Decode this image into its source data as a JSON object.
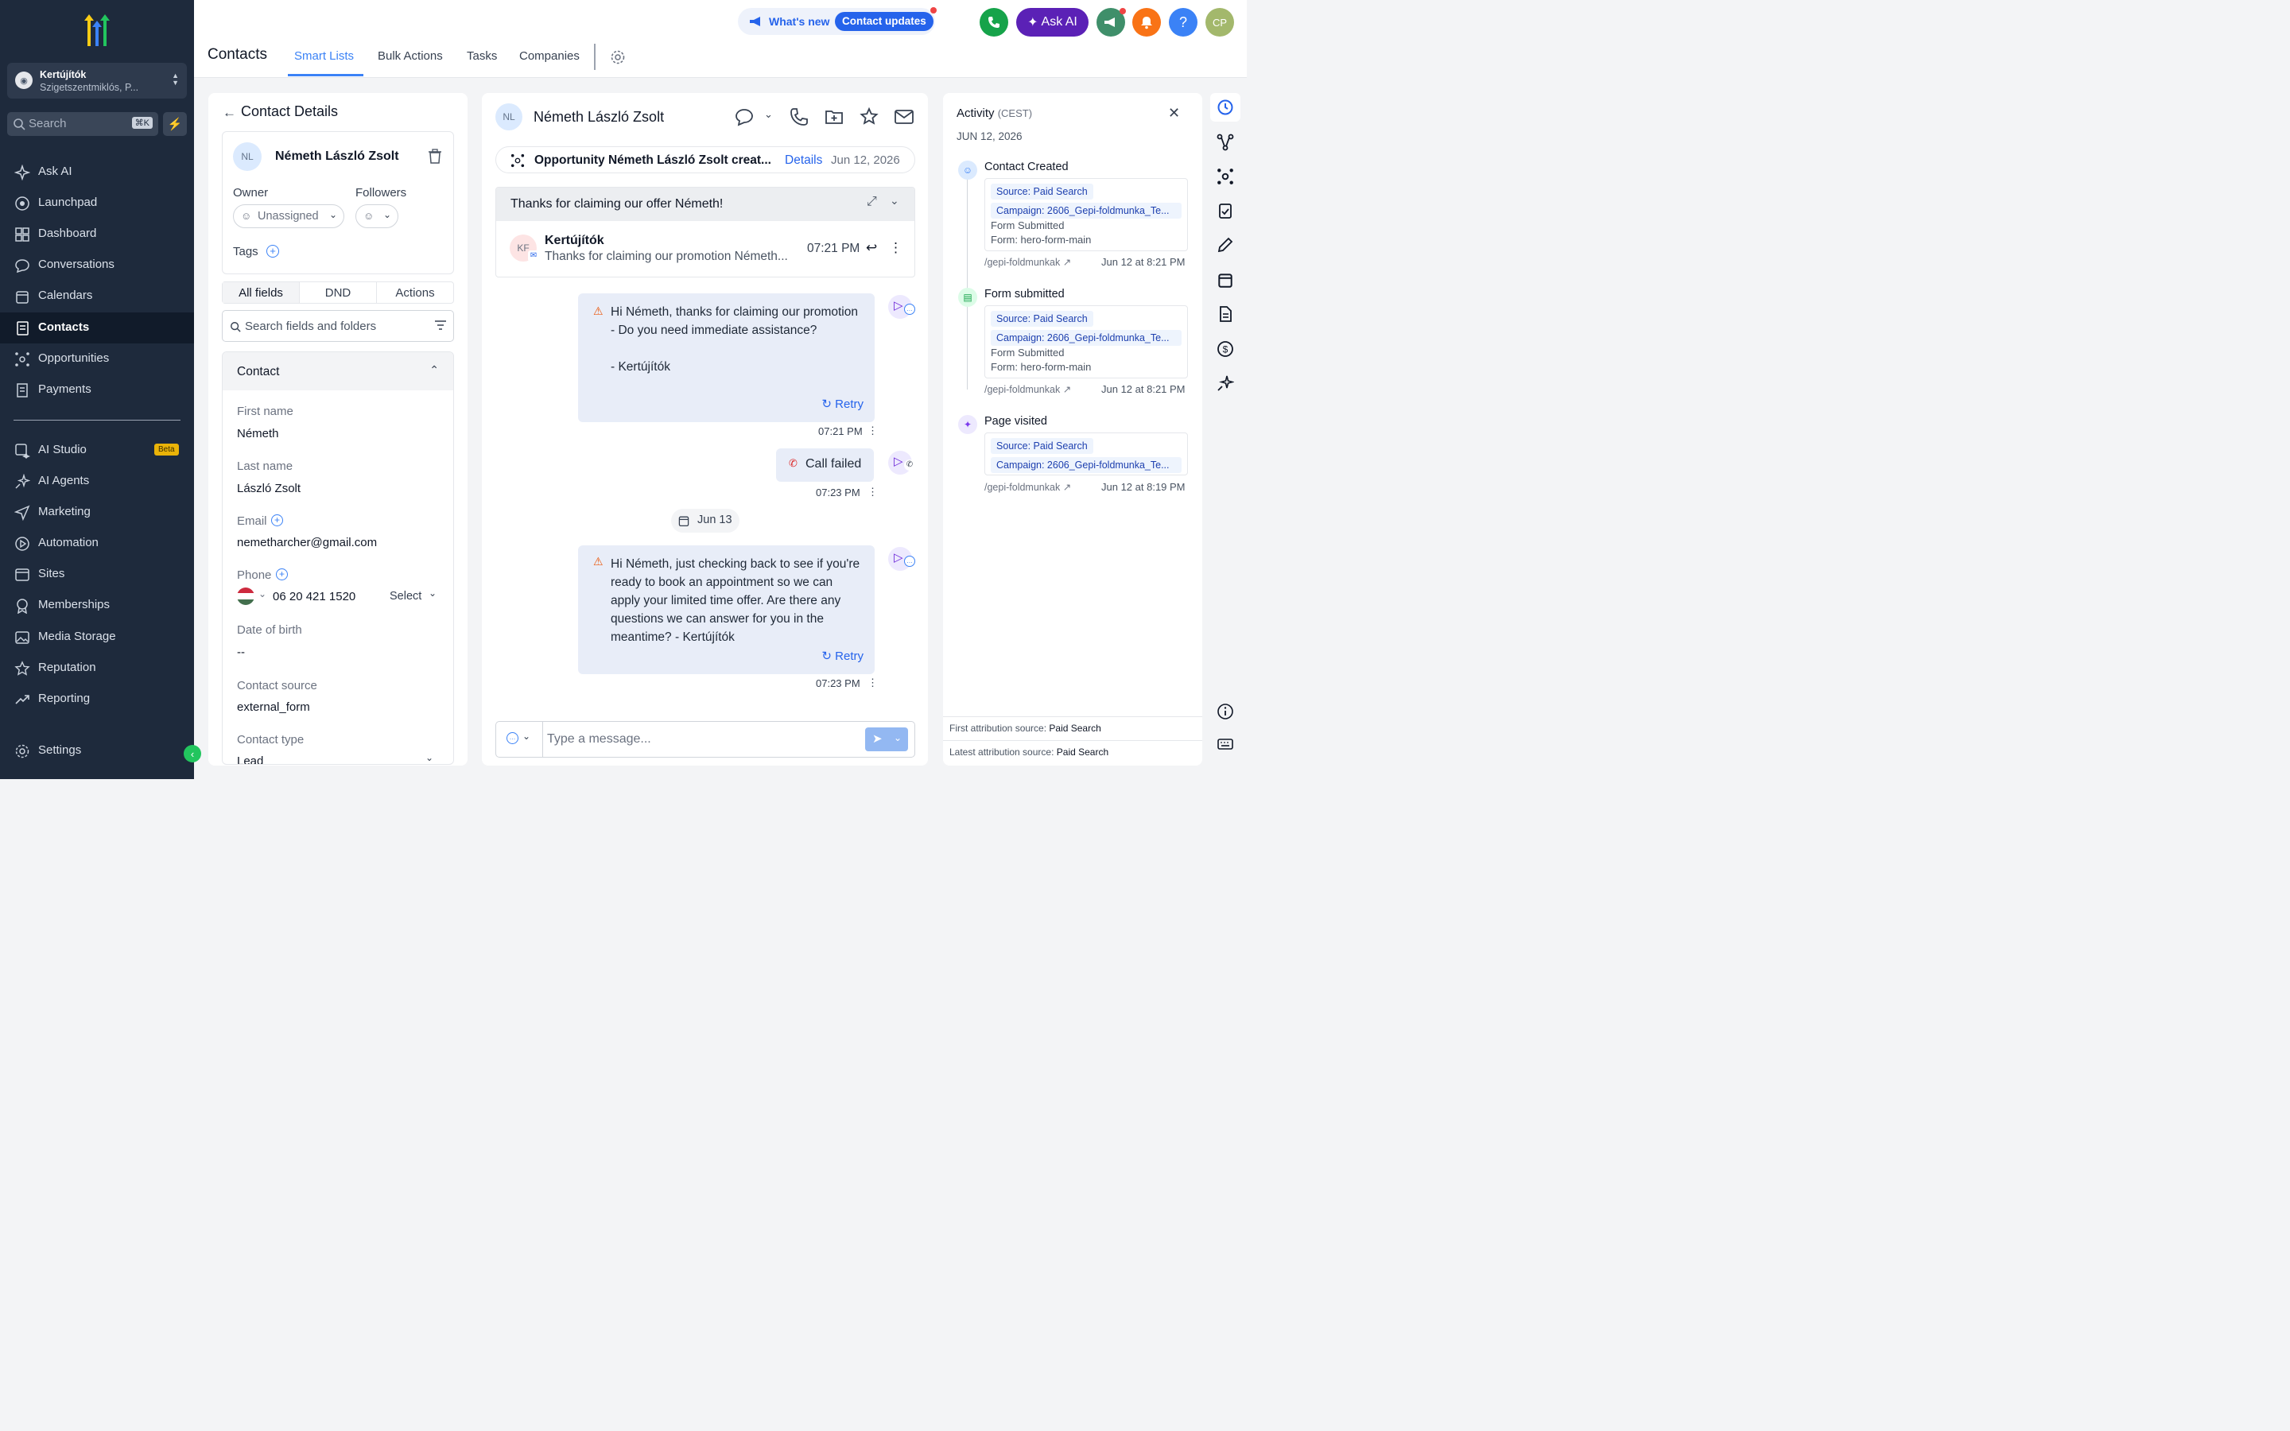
{
  "sidebar": {
    "location_name": "Kertújítók",
    "location_sub": "Szigetszentmiklós, P...",
    "search_placeholder": "Search",
    "search_shortcut": "⌘K",
    "items": [
      {
        "label": "Ask AI"
      },
      {
        "label": "Launchpad"
      },
      {
        "label": "Dashboard"
      },
      {
        "label": "Conversations"
      },
      {
        "label": "Calendars"
      },
      {
        "label": "Contacts"
      },
      {
        "label": "Opportunities"
      },
      {
        "label": "Payments"
      },
      {
        "label": "AI Studio",
        "badge": "Beta"
      },
      {
        "label": "AI Agents"
      },
      {
        "label": "Marketing"
      },
      {
        "label": "Automation"
      },
      {
        "label": "Sites"
      },
      {
        "label": "Memberships"
      },
      {
        "label": "Media Storage"
      },
      {
        "label": "Reputation"
      },
      {
        "label": "Reporting"
      },
      {
        "label": "Settings"
      }
    ]
  },
  "header": {
    "title": "Contacts",
    "tabs": [
      "Smart Lists",
      "Bulk Actions",
      "Tasks",
      "Companies"
    ],
    "whats_new": "What's new",
    "contact_updates": "Contact updates",
    "ask_ai": "Ask AI",
    "avatar": "CP"
  },
  "contact": {
    "panel_title": "Contact Details",
    "initials": "NL",
    "name": "Németh László Zsolt",
    "owner_label": "Owner",
    "owner_value": "Unassigned",
    "followers_label": "Followers",
    "tags_label": "Tags",
    "tabs": [
      "All fields",
      "DND",
      "Actions"
    ],
    "search_placeholder": "Search fields and folders",
    "section": "Contact",
    "fields": {
      "first_name_label": "First name",
      "first_name": "Németh",
      "last_name_label": "Last name",
      "last_name": "László Zsolt",
      "email_label": "Email",
      "email": "nemetharcher@gmail.com",
      "phone_label": "Phone",
      "phone": "06 20 421 1520",
      "phone_select": "Select",
      "dob_label": "Date of birth",
      "dob": "--",
      "source_label": "Contact source",
      "source": "external_form",
      "type_label": "Contact type",
      "type": "Lead"
    }
  },
  "conversation": {
    "initials": "NL",
    "name": "Németh László Zsolt",
    "opportunity_text": "Opportunity Németh László Zsolt creat...",
    "opportunity_link": "Details",
    "opportunity_date": "Jun 12, 2026",
    "thread_subject": "Thanks for claiming our offer Németh!",
    "email_initials": "KF",
    "email_from": "Kertújítók",
    "email_preview": "Thanks for claiming our promotion Németh...",
    "email_time": "07:21 PM",
    "messages": [
      {
        "text": "Hi Németh, thanks for claiming our promotion - Do you need immediate assistance?\n\n- Kertújítók",
        "retry": "Retry",
        "time": "07:21 PM"
      },
      {
        "text": "Call failed",
        "time": "07:23 PM"
      },
      {
        "text": "Hi Németh, just checking back to see if you're ready to book an appointment so we can apply your limited time offer. Are there any questions we can answer for you in the meantime? - Kertújítók",
        "retry": "Retry",
        "time": "07:23 PM"
      }
    ],
    "date_divider": "Jun 13",
    "composer_placeholder": "Type a message..."
  },
  "activity": {
    "title": "Activity",
    "tz": "(CEST)",
    "date": "JUN 12, 2026",
    "items": [
      {
        "title": "Contact Created",
        "source": "Source: Paid Search",
        "campaign": "Campaign: 2606_Gepi-foldmunka_Te...",
        "line1": "Form Submitted",
        "line2": "Form: hero-form-main",
        "path": "/gepi-foldmunkak",
        "time": "Jun 12 at 8:21 PM"
      },
      {
        "title": "Form submitted",
        "source": "Source: Paid Search",
        "campaign": "Campaign: 2606_Gepi-foldmunka_Te...",
        "line1": "Form Submitted",
        "line2": "Form: hero-form-main",
        "path": "/gepi-foldmunkak",
        "time": "Jun 12 at 8:21 PM"
      },
      {
        "title": "Page visited",
        "source": "Source: Paid Search",
        "campaign": "Campaign: 2606_Gepi-foldmunka_Te...",
        "path": "/gepi-foldmunkak",
        "time": "Jun 12 at 8:19 PM"
      }
    ],
    "first_attr_label": "First attribution source:",
    "first_attr_value": "Paid Search",
    "latest_attr_label": "Latest attribution source:",
    "latest_attr_value": "Paid Search"
  },
  "colors": {
    "sidebar": "#1e2a3c",
    "accent": "#2563eb",
    "ask_ai": "#5b21b6",
    "phone_btn": "#16a34a",
    "notif_btn": "#f97316",
    "help_btn": "#3b82f6"
  }
}
